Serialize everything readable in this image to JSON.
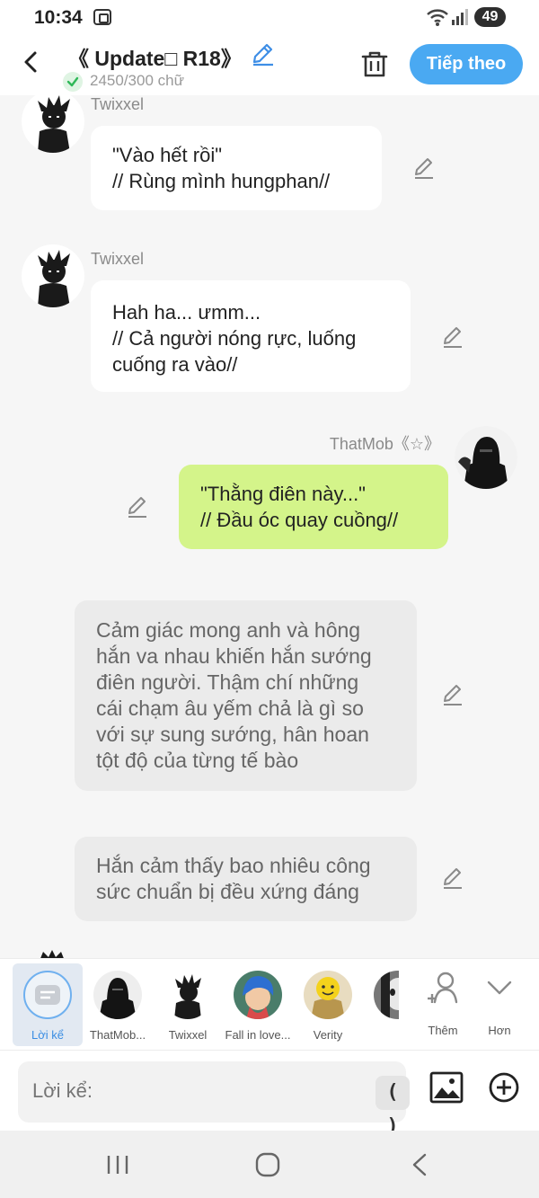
{
  "status_bar": {
    "time": "10:34",
    "battery": "49"
  },
  "header": {
    "title": "《 Update□ R18》",
    "word_count": "2450/300 chữ",
    "next_label": "Tiếp theo"
  },
  "messages": [
    {
      "speaker": "Twixxel",
      "text": "\"Vào hết rồi\"\n// Rùng mình hungphan//"
    },
    {
      "speaker": "Twixxel",
      "text": "Hah ha... ưmm...\n// Cả người nóng rực, luống\ncuống ra vào//"
    },
    {
      "speaker": "ThatMob《☆》",
      "text": "\"Thằng điên này...\"\n// Đầu óc quay cuồng//"
    },
    {
      "speaker": "",
      "text": "Cảm giác mong anh và hông\nhắn va nhau khiến hắn sướng\nđiên người. Thậm chí những\ncái chạm âu yếm chả là gì so\nvới sự sung sướng, hân hoan\ntột độ của từng tế bào"
    },
    {
      "speaker": "",
      "text": "Hắn cảm thấy bao nhiêu công\nsức chuẩn bị đều xứng đáng"
    }
  ],
  "cast": [
    {
      "label": "Lời kể",
      "icon": "narration-icon",
      "active": true
    },
    {
      "label": "ThatMob...",
      "icon": "hooded-figure-avatar"
    },
    {
      "label": "Twixxel",
      "icon": "spiky-hair-avatar"
    },
    {
      "label": "Fall in love...",
      "icon": "blue-hair-avatar"
    },
    {
      "label": "Verity",
      "icon": "yellow-face-avatar"
    },
    {
      "label": "",
      "icon": "mask-avatar"
    }
  ],
  "cast_actions": {
    "add_label": "Thêm",
    "more_label": "Hơn"
  },
  "composer": {
    "placeholder": "Lời kể:",
    "paren_label": "( )"
  },
  "colors": {
    "accent": "#4aa9f2",
    "green_bubble": "#d4f48a",
    "narration_bubble": "#ebebeb"
  }
}
